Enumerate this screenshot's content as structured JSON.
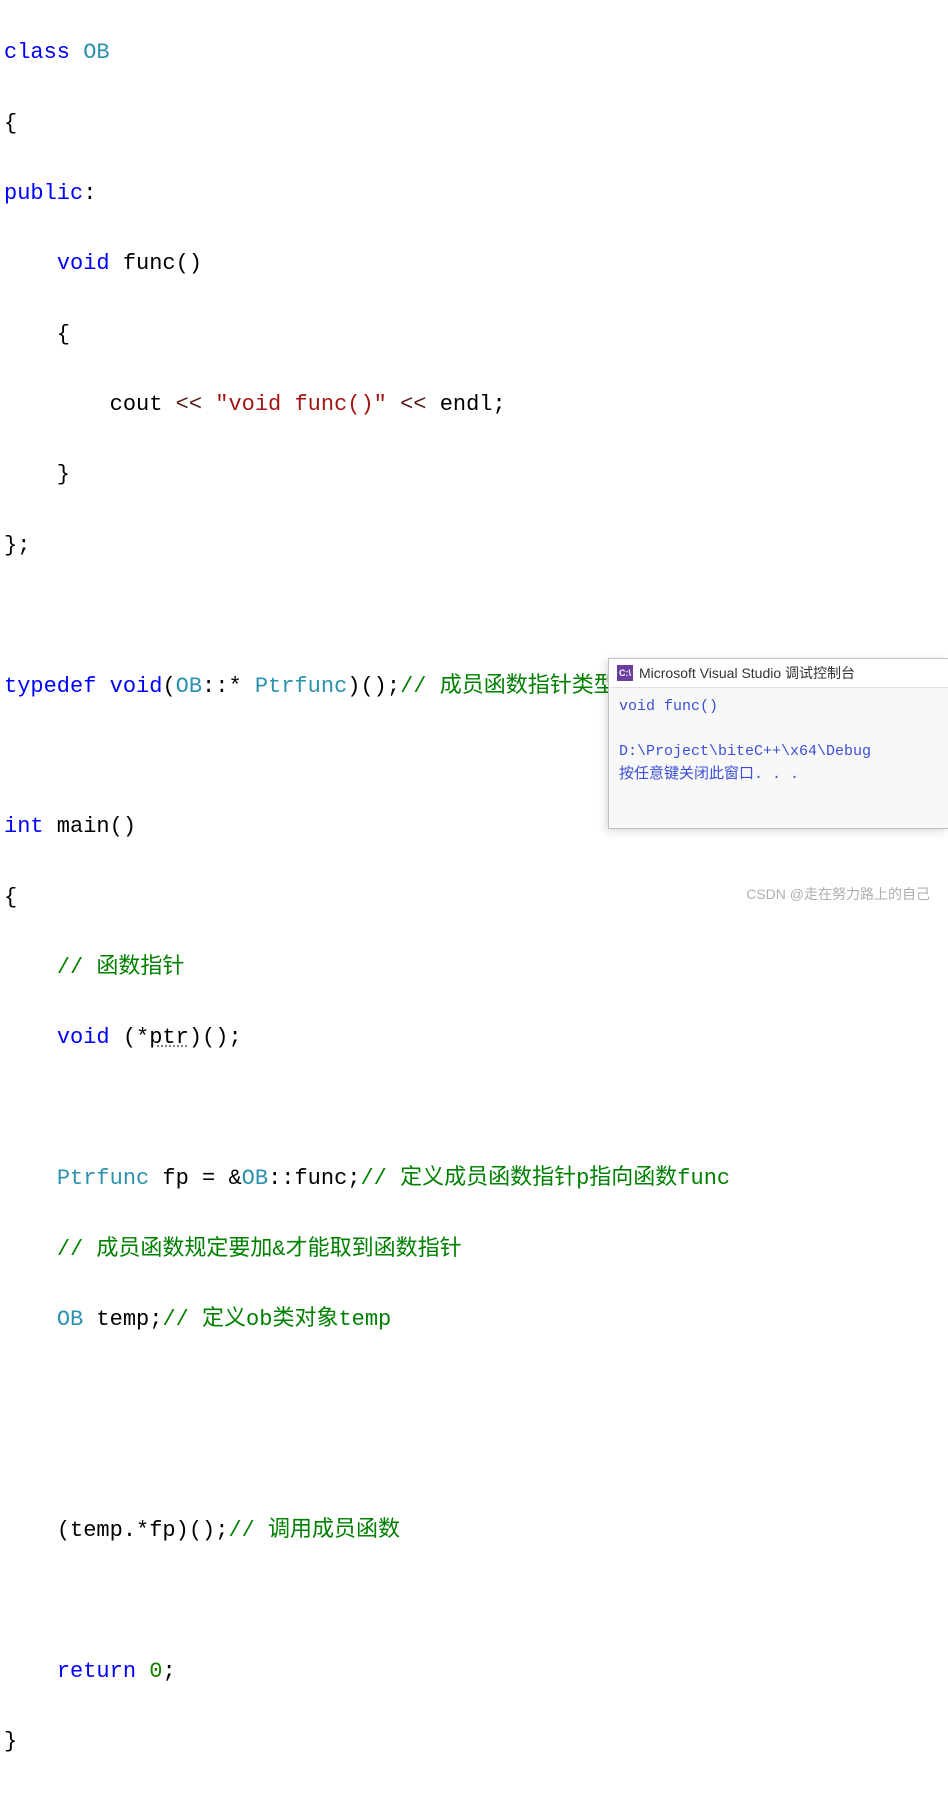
{
  "code": {
    "l1_kw": "class",
    "l1_type": " OB",
    "l2": "{",
    "l3_kw": "public",
    "l3_colon": ":",
    "l4_indent": "    ",
    "l4_kw": "void",
    "l4_func": " func()",
    "l5": "    {",
    "l6_indent": "        ",
    "l6_cout": "cout ",
    "l6_op1": "<<",
    "l6_str": " \"void func()\" ",
    "l6_op2": "<<",
    "l6_endl": " endl;",
    "l7": "    }",
    "l8": "};",
    "l10_typedef": "typedef",
    "l10_void": " void",
    "l10_p1": "(",
    "l10_ob": "OB",
    "l10_dcol": "::* ",
    "l10_ptrfunc": "Ptrfunc",
    "l10_p2": ")();",
    "l10_comment": "// 成员函数指针类型",
    "l12_kw": "int",
    "l12_main": " main()",
    "l13": "{",
    "l14_indent": "    ",
    "l14_comment": "// 函数指针",
    "l15_indent": "    ",
    "l15_kw": "void",
    "l15_p1": " (*",
    "l15_ptr": "ptr",
    "l15_p2": ")();",
    "l17_indent": "    ",
    "l17_type": "Ptrfunc",
    "l17_fp": " fp = &",
    "l17_ob": "OB",
    "l17_dcol": "::",
    "l17_func": "func",
    "l17_semi": ";",
    "l17_comment": "// 定义成员函数指针p指向函数func",
    "l18_indent": "    ",
    "l18_comment": "// 成员函数规定要加&才能取到函数指针",
    "l19_indent": "    ",
    "l19_type": "OB",
    "l19_temp": " temp;",
    "l19_comment": "// 定义ob类对象temp",
    "l22_indent": "    ",
    "l22_call": "(temp.*fp)();",
    "l22_comment": "// 调用成员函数",
    "l24_indent": "    ",
    "l24_kw": "return",
    "l24_zero": " 0",
    "l24_semi": ";",
    "l25": "}"
  },
  "console": {
    "title": "Microsoft Visual Studio 调试控制台",
    "icon_label": "C:\\",
    "line1": "void func()",
    "line2": "D:\\Project\\biteC++\\x64\\Debug",
    "line3": "按任意键关闭此窗口. . ."
  },
  "watermark": "CSDN @走在努力路上的自己"
}
